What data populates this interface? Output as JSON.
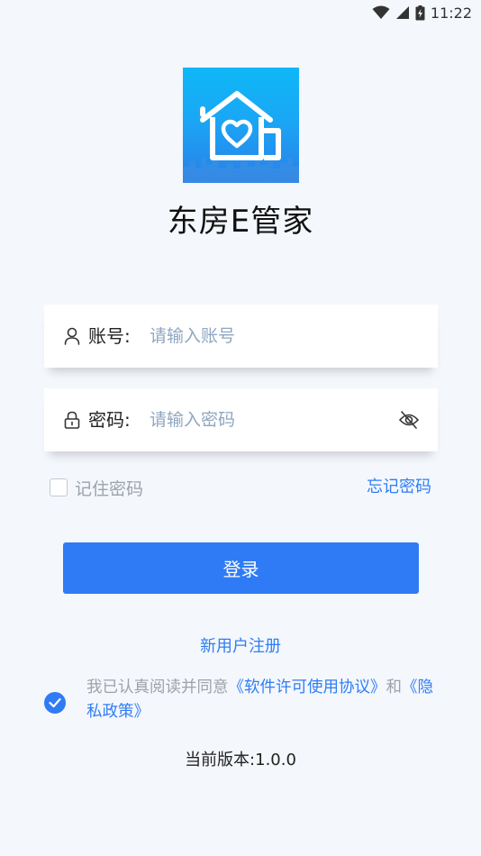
{
  "status_bar": {
    "time": "11:22",
    "icons": [
      "wifi-icon",
      "cell-signal-icon",
      "battery-charging-icon"
    ]
  },
  "app": {
    "name": "东房E管家",
    "logo_icon": "house-heart-icon",
    "logo_colors": [
      "#0fb7f7",
      "#2a7fe8"
    ]
  },
  "account": {
    "label": "账号:",
    "placeholder": "请输入账号",
    "value": "",
    "icon": "user-icon"
  },
  "password": {
    "label": "密码:",
    "placeholder": "请输入密码",
    "value": "",
    "icon": "lock-icon",
    "toggle_icon": "eye-off-icon"
  },
  "remember": {
    "label": "记住密码",
    "checked": false
  },
  "forgot_label": "忘记密码",
  "login_label": "登录",
  "register_label": "新用户注册",
  "agreement": {
    "checked": true,
    "prefix": "我已认真阅读并同意",
    "license_link": "《软件许可使用协议》",
    "conjunction": "和",
    "privacy_link": "《隐私政策》"
  },
  "version": "当前版本:1.0.0",
  "colors": {
    "primary": "#2f7bf5",
    "link": "#2f7ef6",
    "background": "#f4f7fc",
    "placeholder": "#8fa6c2"
  }
}
